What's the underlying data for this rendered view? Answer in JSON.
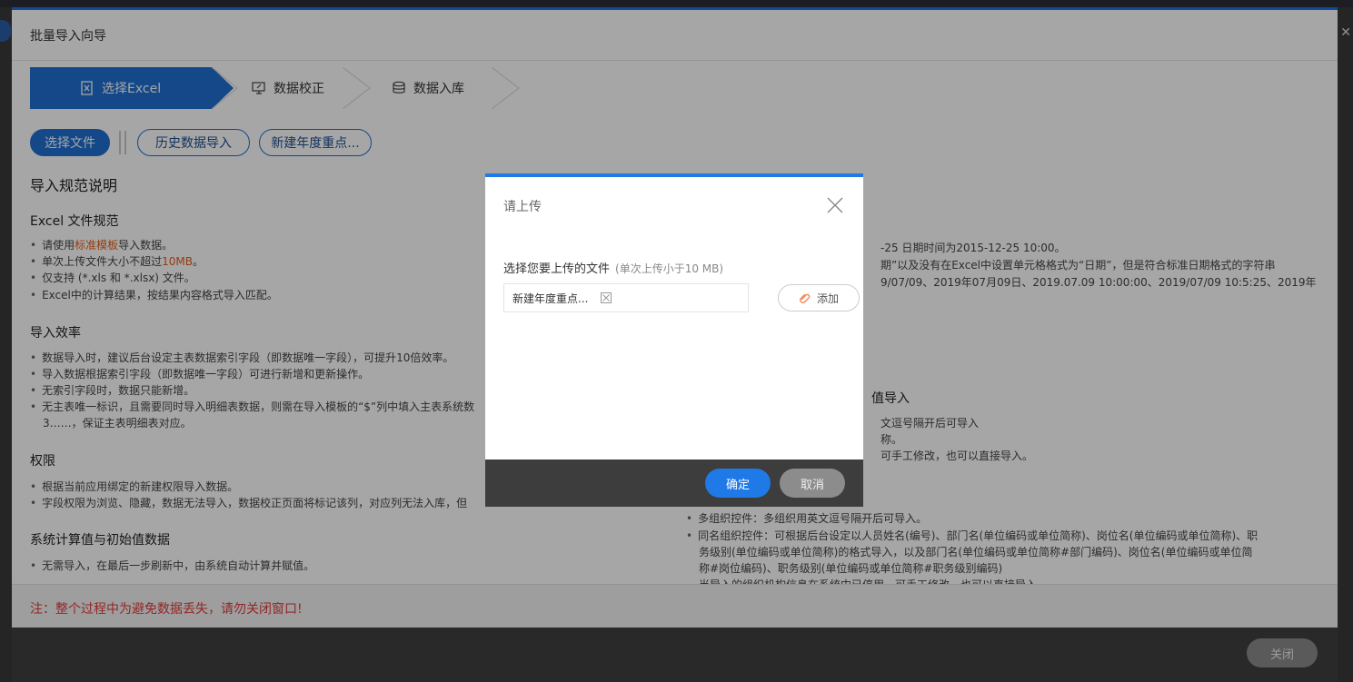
{
  "wizard": {
    "title": "批量导入向导",
    "steps": [
      {
        "label": "选择Excel"
      },
      {
        "label": "数据校正"
      },
      {
        "label": "数据入库"
      }
    ],
    "buttons": {
      "select_file": "选择文件",
      "history_import": "历史数据导入",
      "new_year_key": "新建年度重点..."
    },
    "spec": {
      "title": "导入规范说明",
      "excel": {
        "heading": "Excel 文件规范",
        "items": [
          {
            "pre": "请使用",
            "link": "标准模板",
            "post": "导入数据。"
          },
          {
            "pre": "单次上传文件大小不超过",
            "link": "10MB",
            "post": "。"
          },
          {
            "text": "仅支持 (*.xls 和 *.xlsx) 文件。"
          },
          {
            "text": "Excel中的计算结果，按结果内容格式导入匹配。"
          }
        ]
      },
      "efficiency": {
        "heading": "导入效率",
        "items": [
          "数据导入时，建议后台设定主表数据索引字段（即数据唯一字段），可提升10倍效率。",
          "导入数据根据索引字段（即数据唯一字段）可进行新增和更新操作。",
          "无索引字段时，数据只能新增。",
          "无主表唯一标识，且需要同时导入明细表数据，则需在导入模板的“$”列中填入主表系统数",
          "3……，保证主表明细表对应。"
        ]
      },
      "permission": {
        "heading": "权限",
        "items": [
          "根据当前应用绑定的新建权限导入数据。",
          "字段权限为浏览、隐藏，数据无法导入，数据校正页面将标记该列，对应列无法入库，但"
        ]
      },
      "system_calc": {
        "heading": "系统计算值与初始值数据",
        "items": [
          "无需导入，在最后一步刷新中，由系统自动计算并赋值。"
        ]
      },
      "right": {
        "lines": [
          "-25 日期时间为2015-12-25 10:00。",
          "期”以及没有在Excel中设置单元格格式为“日期”，但是符合标准日期格式的字符串",
          "9/07/09、2019年07月09日、2019.07.09 10:00:00、2019/07/09 10:5:25、2019年"
        ],
        "heading_partial": "值导入",
        "lines2": [
          "文逗号隔开后可导入",
          "称。",
          "可手工修改，也可以直接导入。"
        ],
        "lines3": [
          "多组织控件：多组织用英文逗号隔开后可导入。",
          "同名组织控件：可根据后台设定以人员姓名(编号)、部门名(单位编码或单位简称)、岗位名(单位编码或单位简称)、职",
          "务级别(单位编码或单位简称)的格式导入，以及部门名(单位编码或单位简称#部门编码)、岗位名(单位编码或单位简",
          "称#岗位编码)、职务级别(单位编码或单位简称#职务级别编码)",
          "当导入的组织机构信息在系统中已停用，可手工修改，也可以直接导入。"
        ]
      }
    },
    "note": "注：整个过程中为避免数据丢失，请勿关闭窗口!",
    "close_label": "关闭"
  },
  "modal": {
    "title": "请上传",
    "label": "选择您要上传的文件",
    "hint": "(单次上传小于10 MB)",
    "file_name": "新建年度重点...",
    "add_label": "添加",
    "ok_label": "确定",
    "cancel_label": "取消"
  },
  "colors": {
    "primary": "#1f6fd2",
    "accent_link": "#e55c17",
    "warning": "#e23a3a"
  }
}
